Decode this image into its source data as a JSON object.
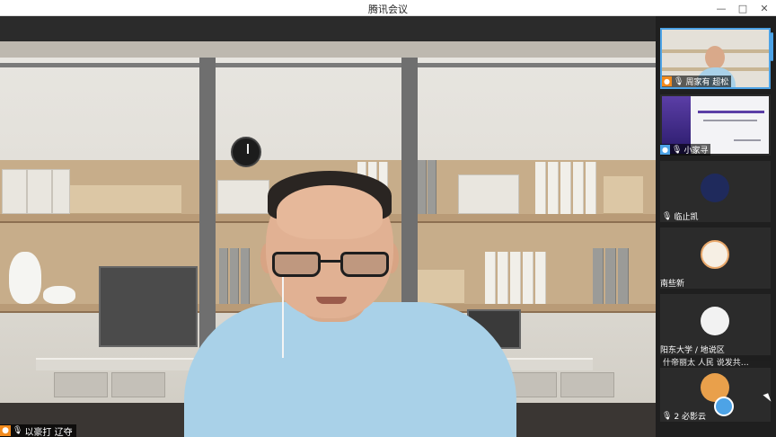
{
  "window": {
    "title": "腾讯会议"
  },
  "main_speaker": {
    "name": "以豪打 辽夺"
  },
  "participants": [
    {
      "name": "周家有 超松",
      "active": true
    },
    {
      "name": "小家寻"
    },
    {
      "name": "临止凯"
    },
    {
      "name": "南些新"
    },
    {
      "name": "阳东大学 / 地说区"
    },
    {
      "name": "2 必影云"
    }
  ],
  "overlay": {
    "text": "什帝丽太 人民   说发共…"
  },
  "icons": {
    "user": "user-icon",
    "mic": "mic-icon"
  },
  "colors": {
    "accent": "#4da3e6",
    "label_icon": "#f28a1c"
  }
}
